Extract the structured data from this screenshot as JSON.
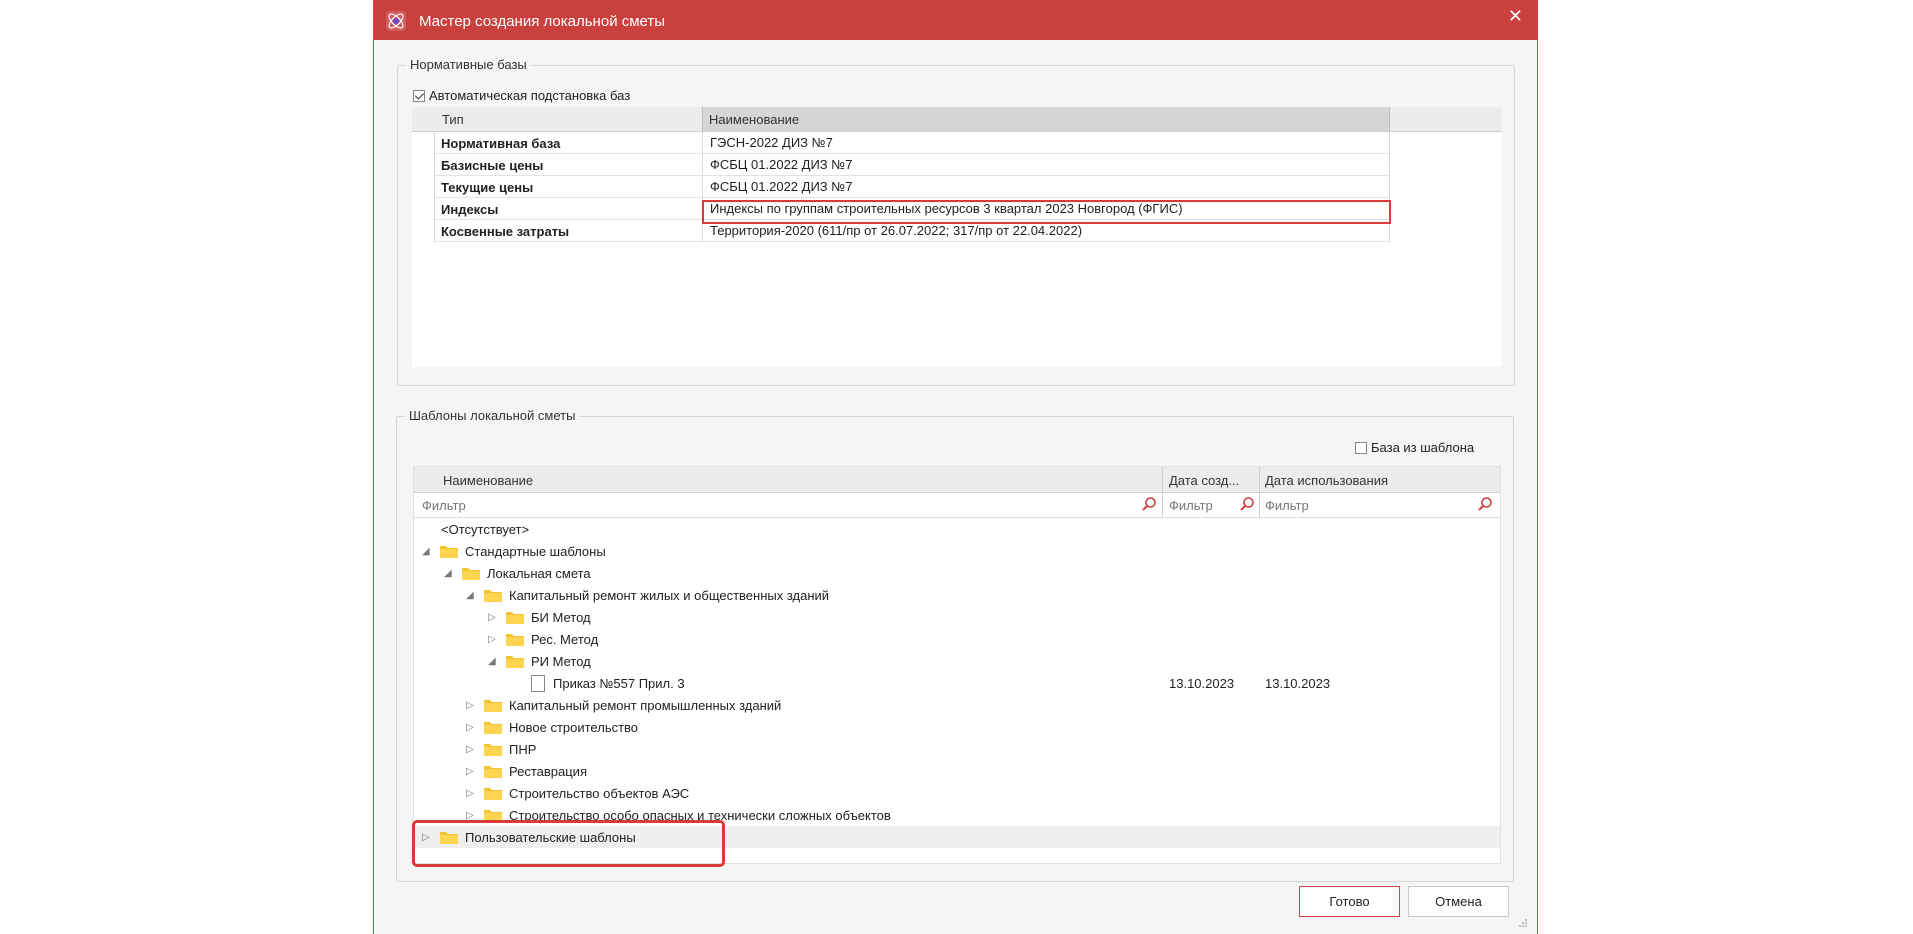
{
  "window": {
    "title": "Мастер создания локальной сметы",
    "close_glyph": "✕"
  },
  "bases_group": {
    "title": "Нормативные базы",
    "auto_checkbox_label": "Автоматическая подстановка баз",
    "auto_checked": true,
    "columns": [
      "Тип",
      "Наименование"
    ],
    "rows": [
      {
        "type": "Нормативная база",
        "name": "ГЭСН-2022 ДИЗ №7"
      },
      {
        "type": "Базисные цены",
        "name": "ФСБЦ 01.2022 ДИЗ №7"
      },
      {
        "type": "Текущие цены",
        "name": "ФСБЦ 01.2022 ДИЗ №7"
      },
      {
        "type": "Индексы",
        "name": "Индексы по группам строительных ресурсов 3 квартал 2023 Новгород (ФГИС)"
      },
      {
        "type": "Косвенные затраты",
        "name": "Территория-2020 (611/пр от 26.07.2022; 317/пр от 22.04.2022)"
      }
    ]
  },
  "templates_group": {
    "title": "Шаблоны локальной сметы",
    "base_from_template_label": "База из шаблона",
    "base_from_template_checked": false,
    "columns": {
      "name": "Наименование",
      "created": "Дата созд...",
      "used": "Дата использования"
    },
    "filter_placeholder": "Фильтр",
    "tree": [
      {
        "label": "<Отсутствует>"
      },
      {
        "label": "Стандартные шаблоны"
      },
      {
        "label": "Локальная смета"
      },
      {
        "label": "Капитальный ремонт жилых и общественных зданий"
      },
      {
        "label": "БИ Метод"
      },
      {
        "label": "Рес. Метод"
      },
      {
        "label": "РИ Метод"
      },
      {
        "label": "Приказ №557 Прил. 3",
        "created": "13.10.2023",
        "used": "13.10.2023"
      },
      {
        "label": "Капитальный ремонт промышленных зданий"
      },
      {
        "label": "Новое строительство"
      },
      {
        "label": "ПНР"
      },
      {
        "label": "Реставрация"
      },
      {
        "label": "Строительство объектов АЭС"
      },
      {
        "label": "Строительство особо опасных и технически сложных объектов"
      },
      {
        "label": "Пользовательские шаблоны"
      }
    ]
  },
  "buttons": {
    "done": "Готово",
    "cancel": "Отмена"
  },
  "colors": {
    "titlebar": "#c9403f",
    "highlight": "#d93a3a"
  }
}
